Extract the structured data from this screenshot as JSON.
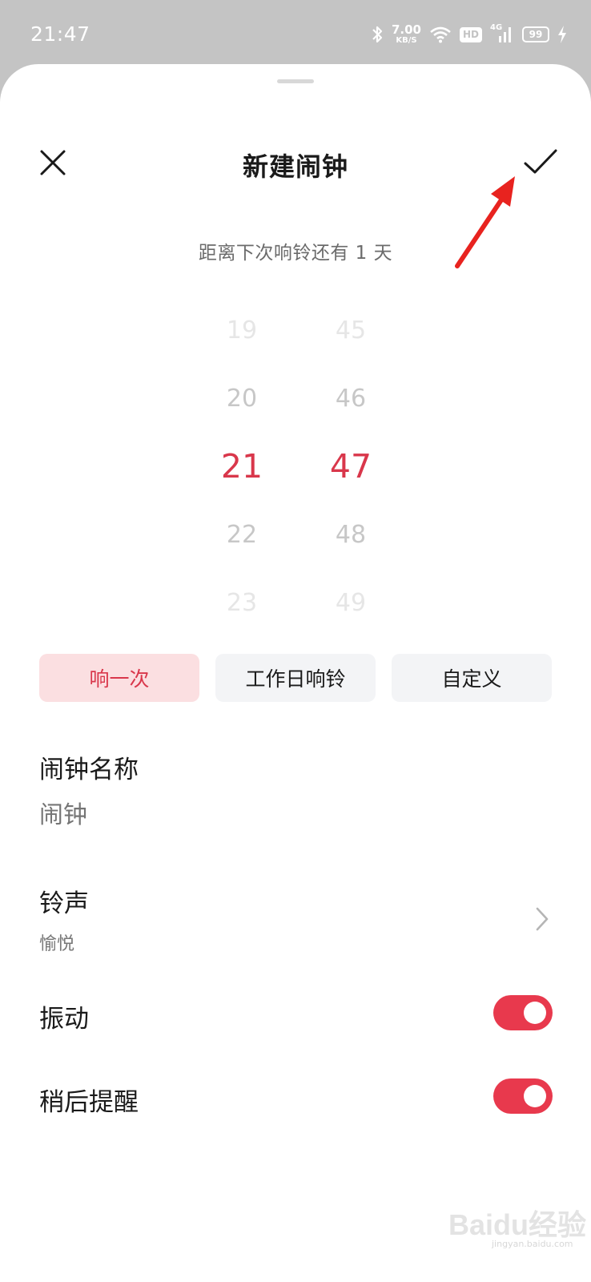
{
  "status_bar": {
    "time": "21:47",
    "net_speed_value": "7.00",
    "net_speed_unit": "KB/S",
    "hd": "HD",
    "network": "4G",
    "battery": "99",
    "icons": [
      "bluetooth-icon",
      "wifi-icon",
      "signal-icon",
      "charging-icon"
    ]
  },
  "header": {
    "title": "新建闹钟",
    "close_icon": "close-icon",
    "confirm_icon": "check-icon"
  },
  "countdown": "距离下次响铃还有 1 天",
  "time_picker": {
    "hours": [
      "19",
      "20",
      "21",
      "22",
      "23"
    ],
    "minutes": [
      "45",
      "46",
      "47",
      "48",
      "49"
    ],
    "selected_hour": "21",
    "selected_minute": "47"
  },
  "repeat_options": {
    "once": "响一次",
    "workday": "工作日响铃",
    "custom": "自定义",
    "selected": "once"
  },
  "alarm_name": {
    "label": "闹钟名称",
    "placeholder": "闹钟",
    "value": ""
  },
  "ringtone": {
    "label": "铃声",
    "value": "愉悦"
  },
  "vibrate": {
    "label": "振动",
    "enabled": true
  },
  "snooze": {
    "label": "稍后提醒",
    "enabled": true
  },
  "watermark": {
    "text": "Baidu经验",
    "sub": "jingyan.baidu.com"
  },
  "colors": {
    "accent": "#e8394d",
    "accent_text": "#d9374b",
    "selected_bg": "#fbdfe1",
    "annotation_arrow": "#e8231f"
  }
}
